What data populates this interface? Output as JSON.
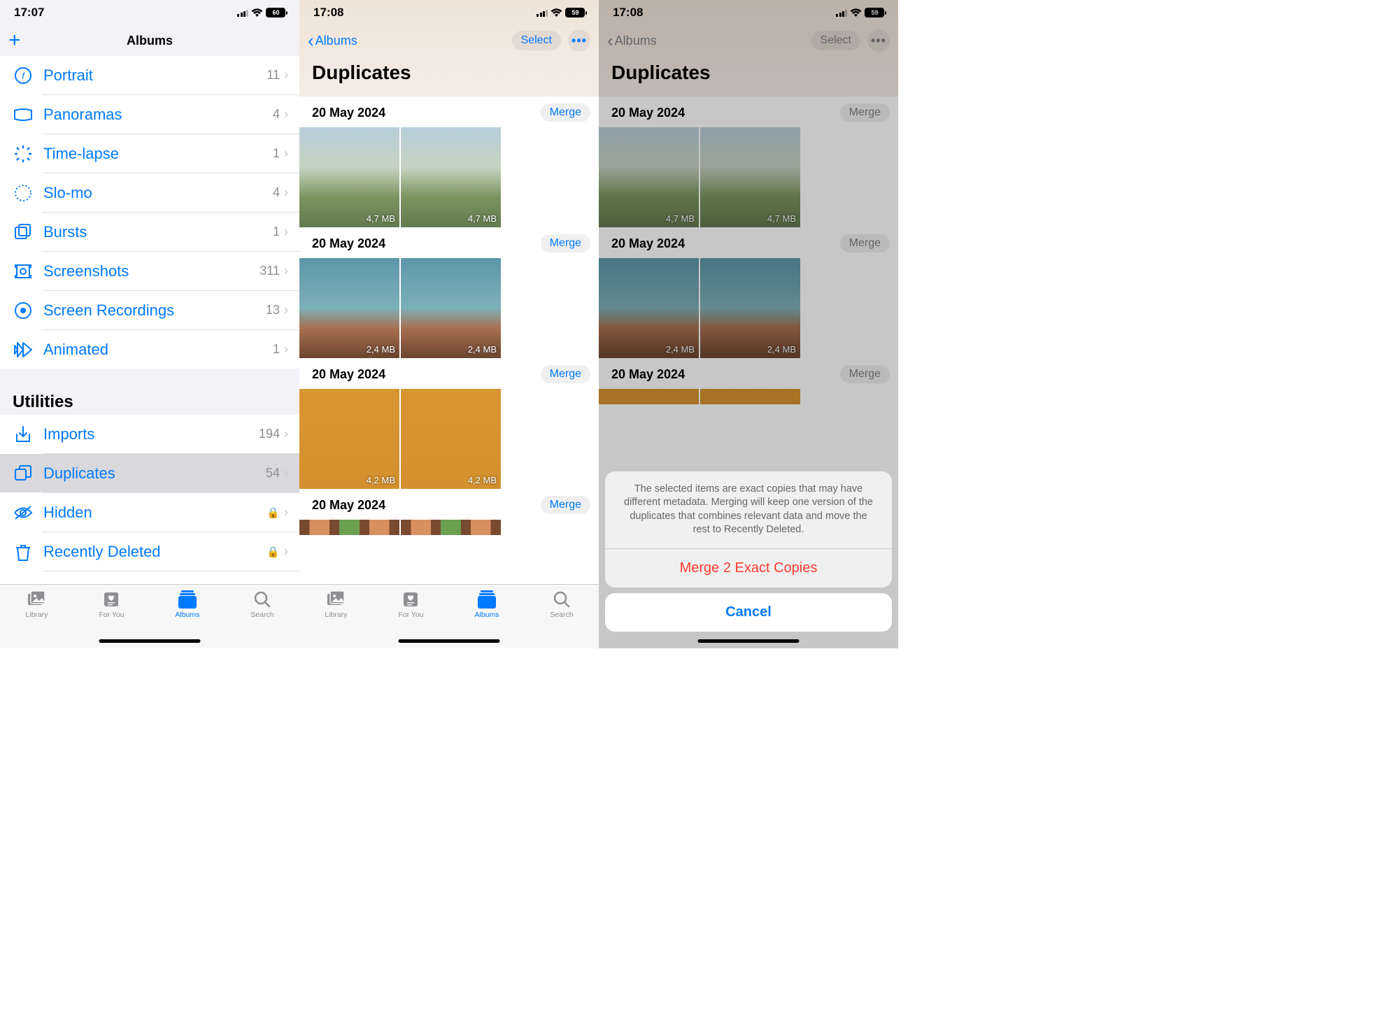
{
  "screen1": {
    "time": "17:07",
    "battery": "60",
    "nav_title": "Albums",
    "rows": [
      {
        "label": "Portrait",
        "count": "11"
      },
      {
        "label": "Panoramas",
        "count": "4"
      },
      {
        "label": "Time-lapse",
        "count": "1"
      },
      {
        "label": "Slo-mo",
        "count": "4"
      },
      {
        "label": "Bursts",
        "count": "1"
      },
      {
        "label": "Screenshots",
        "count": "311"
      },
      {
        "label": "Screen Recordings",
        "count": "13"
      },
      {
        "label": "Animated",
        "count": "1"
      }
    ],
    "utilities_title": "Utilities",
    "util_rows": [
      {
        "label": "Imports",
        "count": "194"
      },
      {
        "label": "Duplicates",
        "count": "54"
      },
      {
        "label": "Hidden"
      },
      {
        "label": "Recently Deleted"
      }
    ],
    "tabs": {
      "library": "Library",
      "foryou": "For You",
      "albums": "Albums",
      "search": "Search"
    }
  },
  "screen2": {
    "time": "17:08",
    "battery": "59",
    "back": "Albums",
    "select": "Select",
    "title": "Duplicates",
    "merge_label": "Merge",
    "groups": [
      {
        "date": "20 May 2024",
        "size": "4,7 MB",
        "kind": "tree"
      },
      {
        "date": "20 May 2024",
        "size": "2,4 MB",
        "kind": "canyon"
      },
      {
        "date": "20 May 2024",
        "size": "4,2 MB",
        "kind": "kids"
      },
      {
        "date": "20 May 2024",
        "size": "",
        "kind": "wood"
      }
    ],
    "tabs": {
      "library": "Library",
      "foryou": "For You",
      "albums": "Albums",
      "search": "Search"
    }
  },
  "screen3": {
    "time": "17:08",
    "battery": "59",
    "back": "Albums",
    "select": "Select",
    "title": "Duplicates",
    "merge_label": "Merge",
    "groups": [
      {
        "date": "20 May 2024",
        "size": "4,7 MB",
        "kind": "tree"
      },
      {
        "date": "20 May 2024",
        "size": "2,4 MB",
        "kind": "canyon"
      },
      {
        "date": "20 May 2024",
        "size": "",
        "kind": "kids"
      }
    ],
    "sheet": {
      "message": "The selected items are exact copies that may have different metadata. Merging will keep one version of the duplicates that combines relevant data and move the rest to Recently Deleted.",
      "action": "Merge 2 Exact Copies",
      "cancel": "Cancel"
    }
  }
}
